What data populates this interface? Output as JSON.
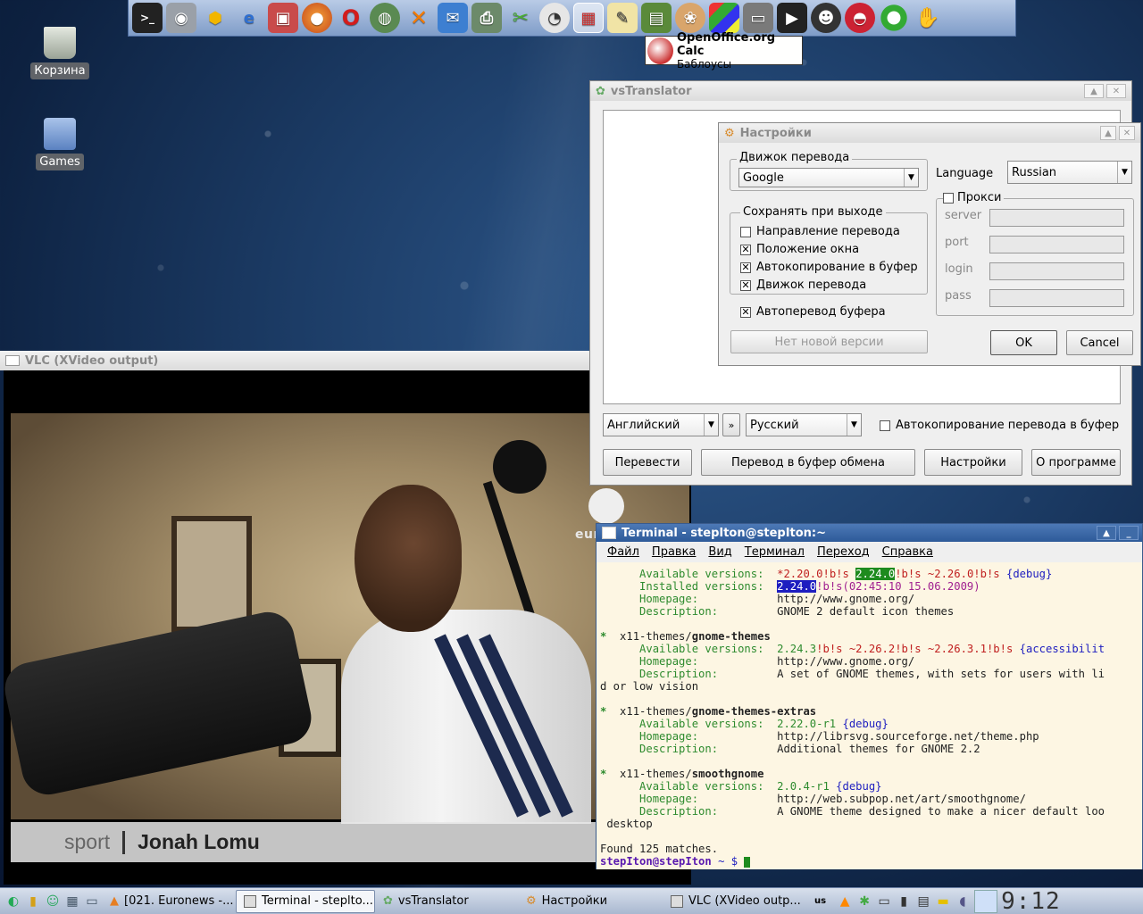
{
  "launcher": {
    "icons": [
      "terminal-icon",
      "screenshot-icon",
      "apps-icon",
      "ie-icon",
      "save-icon",
      "firefox-icon",
      "opera-icon",
      "network-icon",
      "chat-icon",
      "messenger-icon",
      "printer-icon",
      "tools-icon",
      "clock-icon",
      "calc-icon",
      "editor-icon",
      "books-icon",
      "paint-icon",
      "windows-icon",
      "drive-icon",
      "video-icon",
      "penguin-icon",
      "toaster-icon",
      "lifering-icon",
      "hand-icon"
    ],
    "active_icon": "calc-icon",
    "tooltip": {
      "title": "OpenOffice.org Calc",
      "subtitle": "Баблоусы"
    }
  },
  "desktop_icons": [
    {
      "label": "Корзина",
      "icon": "trash-icon"
    },
    {
      "label": "Games",
      "icon": "folder-icon"
    }
  ],
  "vstranslator": {
    "title": "vsTranslator",
    "from_lang": "Английский",
    "swap": "»",
    "to_lang": "Русский",
    "autocopy_label": "Автокопирование перевода в буфер",
    "buttons": {
      "translate": "Перевести",
      "translate_clipboard": "Перевод в буфер обмена",
      "settings": "Настройки",
      "about": "О программе"
    }
  },
  "settings": {
    "title": "Настройки",
    "engine_group": "Движок перевода",
    "engine_value": "Google",
    "language_label": "Language",
    "language_value": "Russian",
    "save_group": "Сохранять при выходе",
    "save_options": [
      {
        "label": "Направление перевода",
        "checked": false
      },
      {
        "label": "Положение окна",
        "checked": true
      },
      {
        "label": "Автокопирование в буфер",
        "checked": true
      },
      {
        "label": "Движок перевода",
        "checked": true
      }
    ],
    "auto_translate": {
      "label": "Автоперевод буфера",
      "checked": true
    },
    "proxy": {
      "label": "Прокси",
      "checked": false,
      "server": "server",
      "port": "port",
      "login": "login",
      "pass": "pass"
    },
    "no_update": "Нет новой версии",
    "ok": "OK",
    "cancel": "Cancel"
  },
  "vlc": {
    "title": "VLC (XVideo output)",
    "logo": "euronews",
    "caption_left": "sport",
    "caption_right": "Jonah Lomu"
  },
  "terminal": {
    "title": "Terminal - stepIton@stepIton:~",
    "menu": [
      "Файл",
      "Правка",
      "Вид",
      "Терминал",
      "Переход",
      "Справка"
    ],
    "prompt_user": "stepIton@stepIton",
    "prompt_rest": " ~ $ ",
    "found": "Found 125 matches."
  },
  "taskbar": {
    "tasks": [
      {
        "label": "[021. Euronews -...",
        "active": false
      },
      {
        "label": "Terminal - steplto...",
        "active": true
      },
      {
        "label": "vsTranslator",
        "active": false
      },
      {
        "label": "Настройки",
        "active": false
      },
      {
        "label": "VLC (XVideo outp...",
        "active": false
      }
    ],
    "keyboard": "us",
    "clock": "9:12"
  }
}
